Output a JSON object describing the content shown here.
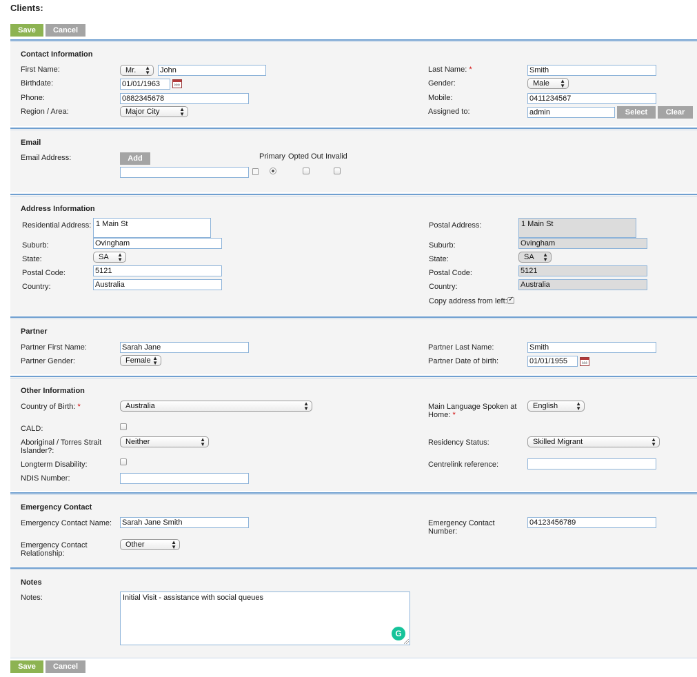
{
  "page": {
    "title": "Clients:"
  },
  "actions": {
    "save": "Save",
    "cancel": "Cancel"
  },
  "contact": {
    "title": "Contact Information",
    "first_name_label": "First Name:",
    "salutation": "Mr.",
    "first_name": "John",
    "last_name_label": "Last Name:",
    "last_name": "Smith",
    "birthdate_label": "Birthdate:",
    "birthdate": "01/01/1963",
    "gender_label": "Gender:",
    "gender": "Male",
    "phone_label": "Phone:",
    "phone": "0882345678",
    "mobile_label": "Mobile:",
    "mobile": "0411234567",
    "region_label": "Region / Area:",
    "region": "Major City",
    "assigned_label": "Assigned to:",
    "assigned": "admin",
    "select_button": "Select",
    "clear_button": "Clear"
  },
  "email": {
    "title": "Email",
    "address_label": "Email Address:",
    "add_button": "Add",
    "col_primary": "Primary",
    "col_opted_out": "Opted Out",
    "col_invalid": "Invalid",
    "address": ""
  },
  "address": {
    "title": "Address Information",
    "res_label": "Residential Address:",
    "res_address": "1 Main St",
    "res_suburb_label": "Suburb:",
    "res_suburb": "Ovingham",
    "res_state_label": "State:",
    "res_state": "SA",
    "res_postcode_label": "Postal Code:",
    "res_postcode": "5121",
    "res_country_label": "Country:",
    "res_country": "Australia",
    "post_label": "Postal Address:",
    "post_address": "1 Main St",
    "post_suburb_label": "Suburb:",
    "post_suburb": "Ovingham",
    "post_state_label": "State:",
    "post_state": "SA",
    "post_postcode_label": "Postal Code:",
    "post_postcode": "5121",
    "post_country_label": "Country:",
    "post_country": "Australia",
    "copy_label": "Copy address from left:",
    "copy_checked": true
  },
  "partner": {
    "title": "Partner",
    "first_name_label": "Partner First Name:",
    "first_name": "Sarah Jane",
    "last_name_label": "Partner Last Name:",
    "last_name": "Smith",
    "gender_label": "Partner Gender:",
    "gender": "Female",
    "dob_label": "Partner Date of birth:",
    "dob": "01/01/1955"
  },
  "other": {
    "title": "Other Information",
    "cob_label": "Country of Birth:",
    "cob": "Australia",
    "lang_label_1": "Main Language Spoken at",
    "lang_label_2": "Home:",
    "lang": "English",
    "cald_label": "CALD:",
    "atsi_label_1": "Aboriginal / Torres Strait",
    "atsi_label_2": "Islander?:",
    "atsi": "Neither",
    "residency_label": "Residency Status:",
    "residency": "Skilled Migrant",
    "disability_label": "Longterm Disability:",
    "centrelink_label": "Centrelink reference:",
    "centrelink": "",
    "ndis_label": "NDIS Number:",
    "ndis": ""
  },
  "emergency": {
    "title": "Emergency Contact",
    "name_label": "Emergency Contact Name:",
    "name": "Sarah Jane Smith",
    "number_label_1": "Emergency Contact",
    "number_label_2": "Number:",
    "number": "04123456789",
    "rel_label_1": "Emergency Contact",
    "rel_label_2": "Relationship:",
    "relationship": "Other"
  },
  "notes": {
    "title": "Notes",
    "label": "Notes:",
    "value": "Initial Visit - assistance with social queues"
  },
  "icons": {
    "calendar": "calendar-icon",
    "trash": "trash-icon",
    "grammarly": "grammarly-icon",
    "select_arrow": "updown-arrow-icon"
  },
  "colors": {
    "save_green": "#8db352",
    "cancel_grey": "#a4a4a4",
    "section_border": "#6f9fd0",
    "section_bg": "#f4f4f4",
    "required": "#d00000"
  }
}
